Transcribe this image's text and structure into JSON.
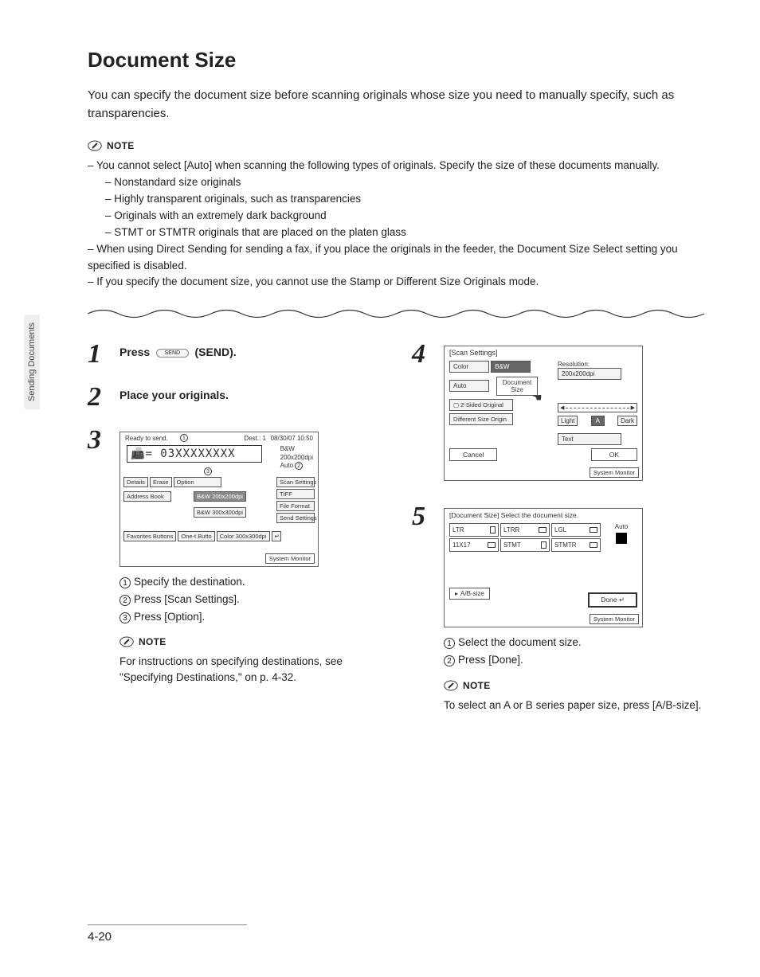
{
  "sidebar_tab": "Sending Documents",
  "title": "Document Size",
  "intro": "You can specify the document size before scanning originals whose size you need to manually specify, such as transparencies.",
  "note_label": "NOTE",
  "top_notes": {
    "n1": "You cannot select [Auto] when scanning the following types of originals. Specify the size of these documents manually.",
    "n1a": "Nonstandard size originals",
    "n1b": "Highly transparent originals, such as transparencies",
    "n1c": "Originals with an extremely dark background",
    "n1d": "STMT or STMTR originals that are placed on the platen glass",
    "n2": "When using Direct Sending for sending a fax, if you place the originals in the feeder, the Document Size Select setting you specified is disabled.",
    "n3": "If you specify the document size, you cannot use the Stamp or Different Size Originals mode."
  },
  "steps": {
    "s1": {
      "num": "1",
      "pre": "Press",
      "btn": "SEND",
      "post": "(SEND)."
    },
    "s2": {
      "num": "2",
      "text": "Place your originals."
    },
    "s3": {
      "num": "3",
      "sub1": "Specify the destination.",
      "sub2": "Press [Scan Settings].",
      "sub3": "Press [Option].",
      "note": "For instructions on specifying destinations, see \"Specifying Destinations,\" on p. 4-32."
    },
    "s4": {
      "num": "4"
    },
    "s5": {
      "num": "5",
      "sub1": "Select the document size.",
      "sub2": "Press [Done].",
      "note": "To select an A or B series paper size, press [A/B-size]."
    }
  },
  "screenshot3": {
    "ready": "Ready to send.",
    "dest": "Dest.:   1",
    "datetime": "08/30/07 10:50",
    "fax": "= 03XXXXXXXX",
    "side_bw": "B&W",
    "side_res": "200x200dpi",
    "side_auto": "Auto",
    "details": "Details",
    "erase": "Erase",
    "option": "Option",
    "address": "Address Book",
    "favorites": "Favorites Buttons",
    "onetouch": "One-t Butto",
    "bw200": "B&W 200x200dpi",
    "bw300": "B&W 300x300dpi",
    "color300": "Color 300x300dpi",
    "scan_settings": "Scan Settings",
    "tiff": "TIFF",
    "file_format": "File Format",
    "send_settings": "Send Settings",
    "sysmon": "System Monitor",
    "c1": "1",
    "c2": "2",
    "c3": "3"
  },
  "screenshot4": {
    "title": "[Scan Settings]",
    "resolution": "Resolution:",
    "res_val": "200x200dpi",
    "color": "Color",
    "bw": "B&W",
    "auto": "Auto",
    "doc_size": "Document Size",
    "two_sided": "2-Sided Original",
    "diff": "Different Size Origin",
    "light": "Light",
    "dark": "Dark",
    "a": "A",
    "text": "Text",
    "cancel": "Cancel",
    "ok": "OK",
    "sysmon": "System Monitor"
  },
  "screenshot5": {
    "title": "[Document Size] Select the document size.",
    "ltr": "LTR",
    "ltrr": "LTRR",
    "lgl": "LGL",
    "_11x17": "11X17",
    "stmt": "STMT",
    "stmtr": "STMTR",
    "auto": "Auto",
    "ab": "A/B-size",
    "done": "Done",
    "sysmon": "System Monitor"
  },
  "footer": "4-20"
}
